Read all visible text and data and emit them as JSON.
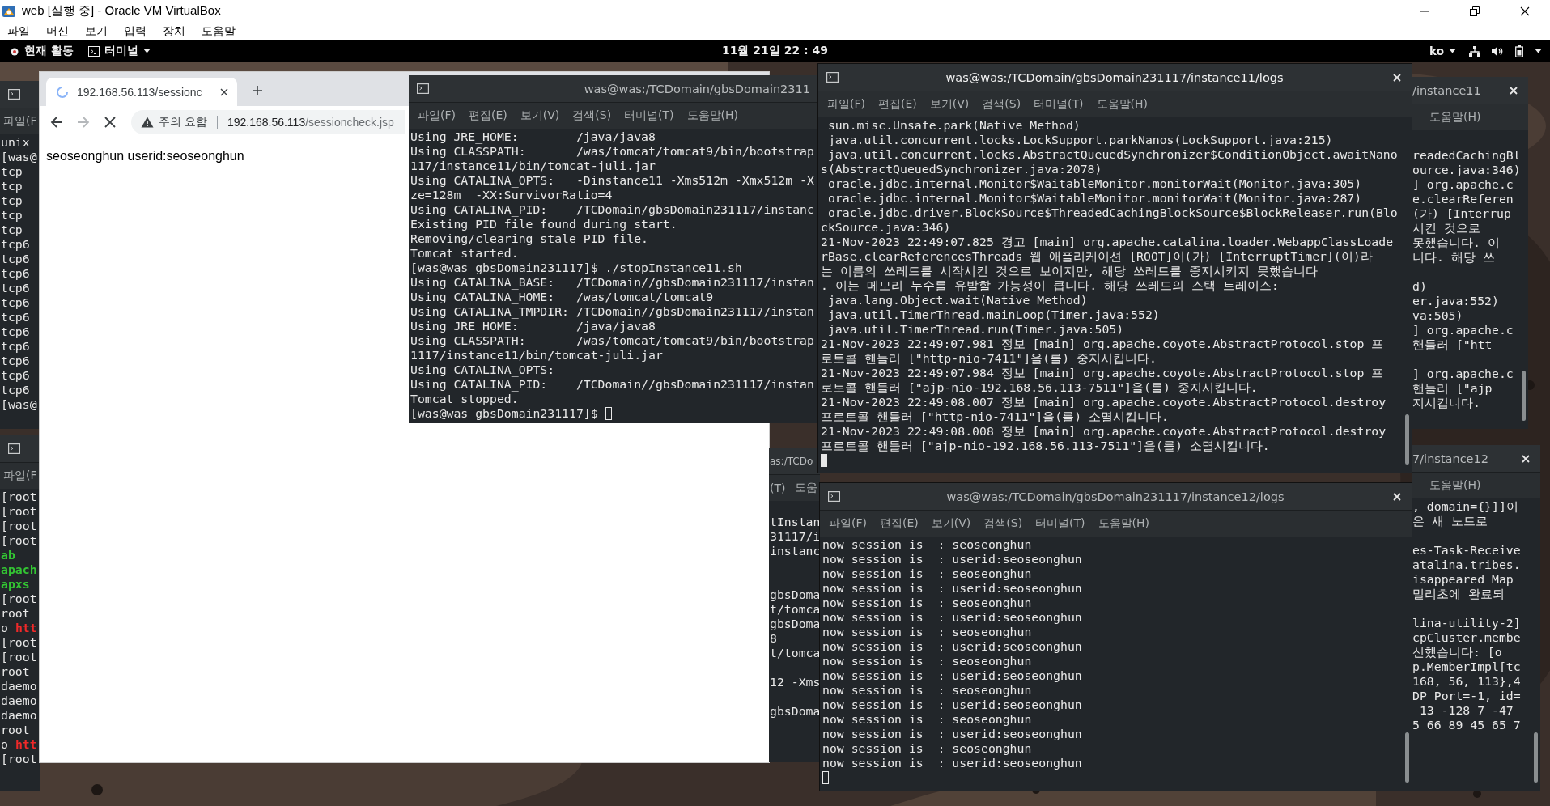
{
  "vbox": {
    "title": "web [실행 중] - Oracle VM VirtualBox",
    "menu": [
      "파일",
      "머신",
      "보기",
      "입력",
      "장치",
      "도움말"
    ]
  },
  "topbar": {
    "activities": "현재 활동",
    "app": "터미널",
    "clock": "11월 21일 22 : 49",
    "input_method": "ko"
  },
  "windows": [
    {
      "kind": "terminal",
      "menu": [
        "파일(F"
      ],
      "lines": [
        "unix",
        "[was@",
        "tcp",
        "tcp",
        "tcp",
        "tcp",
        "tcp",
        "tcp6",
        "tcp6",
        "tcp6",
        "tcp6",
        "tcp6",
        "tcp6",
        "tcp6",
        "tcp6",
        "tcp6",
        "tcp6",
        "tcp6",
        "[was@"
      ]
    },
    {
      "kind": "terminal",
      "menu": [
        "파일(F"
      ],
      "lines": [
        "[root",
        "[root",
        "[root",
        "[root",
        {
          "segments": [
            {
              "text": "ab",
              "color": "#33c433"
            }
          ]
        },
        {
          "segments": [
            {
              "text": "apach",
              "color": "#33c433"
            }
          ]
        },
        {
          "segments": [
            {
              "text": "apxs",
              "color": "#33c433"
            }
          ]
        },
        "[root",
        "root",
        {
          "segments": [
            {
              "text": "o"
            },
            {
              "text": "htt",
              "color": "#ef2929"
            }
          ]
        },
        "[root",
        "[root",
        "root",
        "daemo",
        "daemo",
        "daemo",
        "root",
        {
          "segments": [
            {
              "text": "o"
            },
            {
              "text": "htt",
              "color": "#ef2929"
            }
          ]
        },
        "[root"
      ]
    },
    {
      "kind": "browser",
      "tab": {
        "title": "192.168.56.113/sessionc",
        "loading": true
      },
      "back_disabled": false,
      "forward_disabled": true,
      "security": "주의 요함",
      "url": {
        "host": "192.168.56.113",
        "path": "/sessioncheck.jsp"
      },
      "content": "seoseonghun userid:seoseonghun"
    },
    {
      "kind": "terminal",
      "focused": false,
      "title": "was@was:/TCDomain/gbsDomain2311",
      "menu": [
        "파일(F)",
        "편집(E)",
        "보기(V)",
        "검색(S)",
        "터미널(T)",
        "도움말(H)"
      ],
      "cursor": true,
      "lines": [
        "Using JRE_HOME:        /java/java8",
        "Using CLASSPATH:       /was/tomcat/tomcat9/bin/bootstrap",
        "117/instance11/bin/tomcat-juli.jar",
        "Using CATALINA_OPTS:   -Dinstance11 -Xms512m -Xmx512m -X",
        "ze=128m  -XX:SurvivorRatio=4",
        "Using CATALINA_PID:    /TCDomain/gbsDomain231117/instanc",
        "Existing PID file found during start.",
        "Removing/clearing stale PID file.",
        "Tomcat started.",
        "[was@was gbsDomain231117]$ ./stopInstance11.sh",
        "Using CATALINA_BASE:   /TCDomain//gbsDomain231117/instan",
        "Using CATALINA_HOME:   /was/tomcat/tomcat9",
        "Using CATALINA_TMPDIR: /TCDomain//gbsDomain231117/instan",
        "Using JRE_HOME:        /java/java8",
        "Using CLASSPATH:       /was/tomcat/tomcat9/bin/bootstrap",
        "1117/instance11/bin/tomcat-juli.jar",
        "Using CATALINA_OPTS:",
        "Using CATALINA_PID:    /TCDomain//gbsDomain231117/instan",
        "Tomcat stopped.",
        "[was@was gbsDomain231117]$"
      ]
    },
    {
      "kind": "terminal",
      "focused": false,
      "title": "as:/TCDo",
      "menu": [
        "(T)",
        "도움"
      ],
      "lines": [
        "tInstan",
        "31117/i",
        "instanc",
        {
          "kind": "blank"
        },
        {
          "kind": "blank"
        },
        "gbsDoma",
        "t/tomca",
        "gbsDoma",
        "8",
        "t/tomca",
        {
          "kind": "blank"
        },
        "12 -Xms",
        {
          "kind": "blank"
        },
        "gbsDoma"
      ]
    },
    {
      "kind": "terminal",
      "focused": false,
      "title": "/instance11",
      "menu": [
        "도움말(H)"
      ],
      "lines": [
        "readedCachingBl",
        "ource.java:346)",
        "] org.apache.c",
        "e.clearReferen",
        "(가) [Interrup",
        "시킨 것으로",
        "못했습니다. 이",
        "니다. 해당 쓰",
        {
          "kind": "blank"
        },
        "d)",
        "er.java:552)",
        "va:505)",
        "] org.apache.c",
        "핸들러 [\"htt",
        {
          "kind": "blank"
        },
        "] org.apache.c",
        "핸들러 [\"ajp",
        "지시킵니다."
      ]
    },
    {
      "kind": "terminal",
      "focused": false,
      "title": "7/instance12",
      "menu": [
        "도움말(H)"
      ],
      "lines": [
        ", domain={}]]이",
        "은 새 노드로",
        {
          "kind": "blank"
        },
        "es-Task-Receive",
        "atalina.tribes.",
        "isappeared Map",
        "밀리초에 완료되",
        {
          "kind": "blank"
        },
        "lina-utility-2]",
        "cpCluster.membe",
        "신했습니다: [o",
        "p.MemberImpl[tc",
        "168, 56, 113},4",
        "DP Port=-1, id=",
        " 13 -128 7 -47",
        "5 66 89 45 65 7"
      ]
    },
    {
      "kind": "terminal",
      "focused": true,
      "title": "was@was:/TCDomain/gbsDomain231117/instance11/logs",
      "menu": [
        "파일(F)",
        "편집(E)",
        "보기(V)",
        "검색(S)",
        "터미널(T)",
        "도움말(H)"
      ],
      "cursor": true,
      "lines": [
        " sun.misc.Unsafe.park(Native Method)",
        " java.util.concurrent.locks.LockSupport.parkNanos(LockSupport.java:215)",
        " java.util.concurrent.locks.AbstractQueuedSynchronizer$ConditionObject.awaitNano",
        "s(AbstractQueuedSynchronizer.java:2078)",
        " oracle.jdbc.internal.Monitor$WaitableMonitor.monitorWait(Monitor.java:305)",
        " oracle.jdbc.internal.Monitor$WaitableMonitor.monitorWait(Monitor.java:287)",
        " oracle.jdbc.driver.BlockSource$ThreadedCachingBlockSource$BlockReleaser.run(Blo",
        "ckSource.java:346)",
        "21-Nov-2023 22:49:07.825 경고 [main] org.apache.catalina.loader.WebappClassLoade",
        "rBase.clearReferencesThreads 웹 애플리케이션 [ROOT]이(가) [InterruptTimer](이)라",
        "는 이름의 쓰레드를 시작시킨 것으로 보이지만, 해당 쓰레드를 중지시키지 못했습니다",
        ". 이는 메모리 누수를 유발할 가능성이 큽니다. 해당 쓰레드의 스택 트레이스:",
        " java.lang.Object.wait(Native Method)",
        " java.util.TimerThread.mainLoop(Timer.java:552)",
        " java.util.TimerThread.run(Timer.java:505)",
        "21-Nov-2023 22:49:07.981 정보 [main] org.apache.coyote.AbstractProtocol.stop 프",
        "로토콜 핸들러 [\"http-nio-7411\"]을(를) 중지시킵니다.",
        "21-Nov-2023 22:49:07.984 정보 [main] org.apache.coyote.AbstractProtocol.stop 프",
        "로토콜 핸들러 [\"ajp-nio-192.168.56.113-7511\"]을(를) 중지시킵니다.",
        "21-Nov-2023 22:49:08.007 정보 [main] org.apache.coyote.AbstractProtocol.destroy",
        "프로토콜 핸들러 [\"http-nio-7411\"]을(를) 소멸시킵니다.",
        "21-Nov-2023 22:49:08.008 정보 [main] org.apache.coyote.AbstractProtocol.destroy",
        "프로토콜 핸들러 [\"ajp-nio-192.168.56.113-7511\"]을(를) 소멸시킵니다."
      ]
    },
    {
      "kind": "terminal",
      "focused": false,
      "title": "was@was:/TCDomain/gbsDomain231117/instance12/logs",
      "menu": [
        "파일(F)",
        "편집(E)",
        "보기(V)",
        "검색(S)",
        "터미널(T)",
        "도움말(H)"
      ],
      "cursor": true,
      "lines": [
        "now session is  : seoseonghun",
        "now session is  : userid:seoseonghun",
        "now session is  : seoseonghun",
        "now session is  : userid:seoseonghun",
        "now session is  : seoseonghun",
        "now session is  : userid:seoseonghun",
        "now session is  : seoseonghun",
        "now session is  : userid:seoseonghun",
        "now session is  : seoseonghun",
        "now session is  : userid:seoseonghun",
        "now session is  : seoseonghun",
        "now session is  : userid:seoseonghun",
        "now session is  : seoseonghun",
        "now session is  : userid:seoseonghun",
        "now session is  : seoseonghun",
        "now session is  : userid:seoseonghun"
      ]
    }
  ]
}
